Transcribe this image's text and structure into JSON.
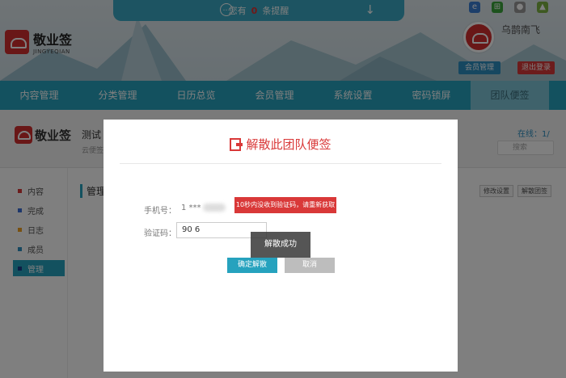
{
  "header": {
    "notice_prefix": "您有",
    "notice_count": "0",
    "notice_suffix": "条提醒",
    "logo_cn": "敬业签",
    "logo_en": "JINGYEQIAN",
    "username": "乌鹊南飞",
    "member_btn": "会员管理",
    "logout_btn": "退出登录",
    "os_icons": [
      "ie-icon",
      "windows-icon",
      "apple-icon",
      "android-icon"
    ]
  },
  "nav": {
    "items": [
      "内容管理",
      "分类管理",
      "日历总览",
      "会员管理",
      "系统设置",
      "密码锁屏",
      "团队便签"
    ],
    "active_index": 6
  },
  "group": {
    "logo_cn": "敬业签",
    "name": "测试",
    "subtitle": "云便签",
    "online_label": "在线：1/",
    "search_placeholder": "搜索",
    "manage_title": "管理",
    "btn_edit": "修改设置",
    "btn_dissolve": "解散团签"
  },
  "sidebar": {
    "items": [
      {
        "label": "内容",
        "color": "#d93838"
      },
      {
        "label": "完成",
        "color": "#3b6fd6"
      },
      {
        "label": "日志",
        "color": "#f0a020"
      },
      {
        "label": "成员",
        "color": "#2d8fc1"
      },
      {
        "label": "管理",
        "color": "#1a3a8a"
      }
    ],
    "active_index": 4
  },
  "modal": {
    "title": "解散此团队便签",
    "phone_label": "手机号：",
    "phone_value": "1 ***",
    "tip": "10秒内没收到验证码，请重新获取",
    "code_label": "验证码：",
    "code_value": "90 6",
    "confirm_btn": "确定解散",
    "cancel_btn": "取消",
    "toast": "解散成功"
  },
  "colors": {
    "primary": "#26a2be",
    "danger": "#d93838"
  }
}
